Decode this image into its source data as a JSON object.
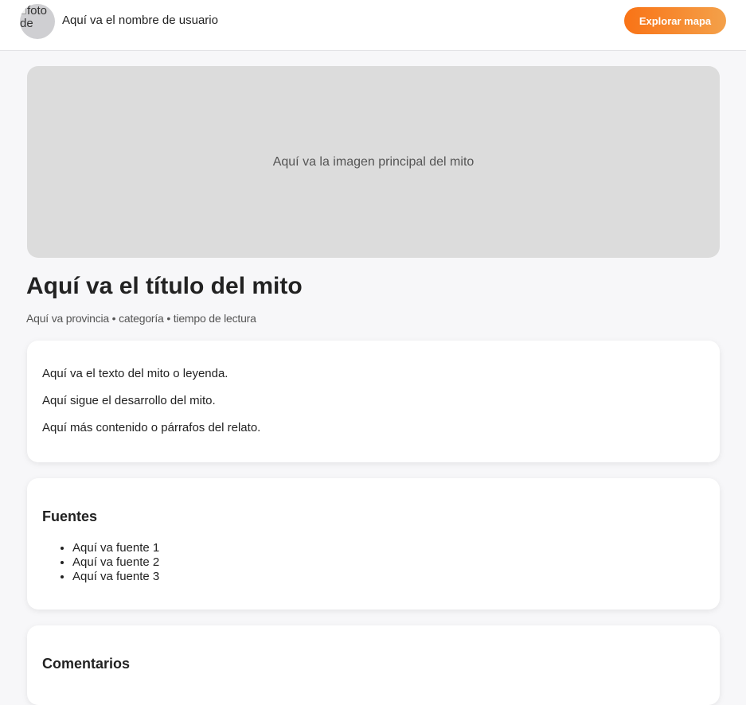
{
  "header": {
    "avatar_alt": "foto de perfil",
    "avatar_visible_text": "foto de",
    "username": "Aquí va el nombre de usuario",
    "explore_button": "Explorar mapa"
  },
  "hero": {
    "placeholder": "Aquí va la imagen principal del mito"
  },
  "myth": {
    "title": "Aquí va el título del mito",
    "meta": "Aquí va provincia • categoría • tiempo de lectura",
    "paragraphs": [
      "Aquí va el texto del mito o leyenda.",
      "Aquí sigue el desarrollo del mito.",
      "Aquí más contenido o párrafos del relato."
    ]
  },
  "sources": {
    "heading": "Fuentes",
    "items": [
      "Aquí va fuente 1",
      "Aquí va fuente 2",
      "Aquí va fuente 3"
    ]
  },
  "comments": {
    "heading": "Comentarios"
  }
}
